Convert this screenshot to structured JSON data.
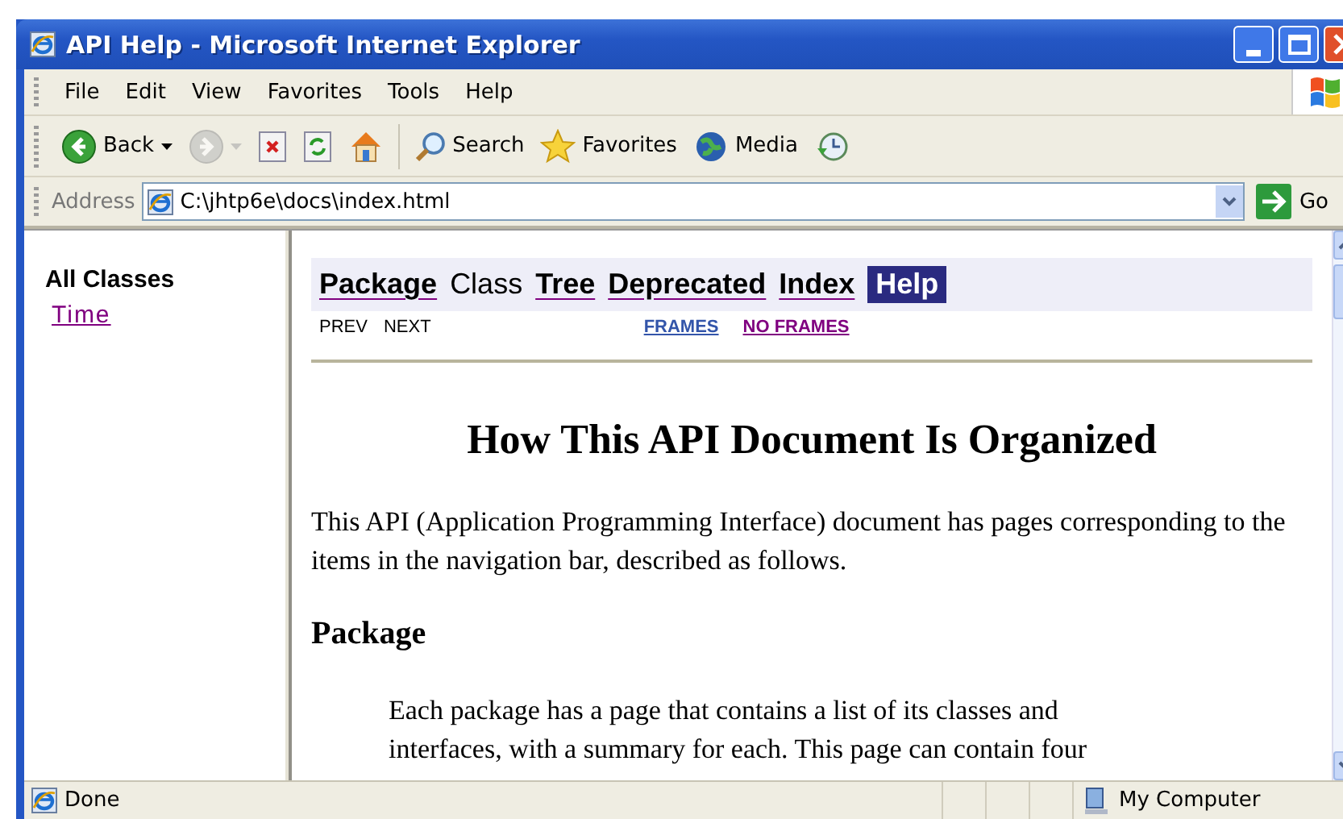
{
  "window": {
    "title": "API Help - Microsoft Internet Explorer"
  },
  "menu": [
    "File",
    "Edit",
    "View",
    "Favorites",
    "Tools",
    "Help"
  ],
  "toolbar": [
    {
      "kind": "back",
      "label": "Back",
      "disabled": false
    },
    {
      "kind": "forward",
      "disabled": true
    },
    {
      "kind": "stop",
      "disabled": false
    },
    {
      "kind": "refresh",
      "disabled": false
    },
    {
      "kind": "home",
      "disabled": false
    },
    {
      "kind": "search",
      "label": "Search",
      "disabled": false
    },
    {
      "kind": "favorites",
      "label": "Favorites",
      "disabled": false
    },
    {
      "kind": "media",
      "label": "Media",
      "disabled": false
    },
    {
      "kind": "history",
      "disabled": false
    }
  ],
  "address_bar": {
    "label": "Address",
    "value": "C:\\jhtp6e\\docs\\index.html",
    "go": "Go"
  },
  "left_frame": {
    "heading": "All Classes",
    "links": [
      "Time"
    ]
  },
  "nav_bar": {
    "items": [
      {
        "label": "Package",
        "kind": "link",
        "selected": false
      },
      {
        "label": "Class",
        "kind": "text",
        "selected": false
      },
      {
        "label": "Tree",
        "kind": "link",
        "selected": false
      },
      {
        "label": "Deprecated",
        "kind": "link",
        "selected": false
      },
      {
        "label": "Index",
        "kind": "link",
        "selected": false
      },
      {
        "label": "Help",
        "kind": "link",
        "selected": true
      }
    ],
    "sub_left": [
      "PREV",
      "NEXT"
    ],
    "sub_right": [
      "FRAMES",
      "NO FRAMES"
    ]
  },
  "document": {
    "title": "How This API Document Is Organized",
    "intro": "This API (Application Programming Interface) document has pages corresponding to the items in the navigation bar, described as follows.",
    "sections": [
      {
        "heading": "Package",
        "text": "Each package has a page that contains a list of its classes and interfaces, with a summary for each. This page can contain four"
      }
    ]
  },
  "status_bar": {
    "text": "Done",
    "zone": "My Computer"
  }
}
